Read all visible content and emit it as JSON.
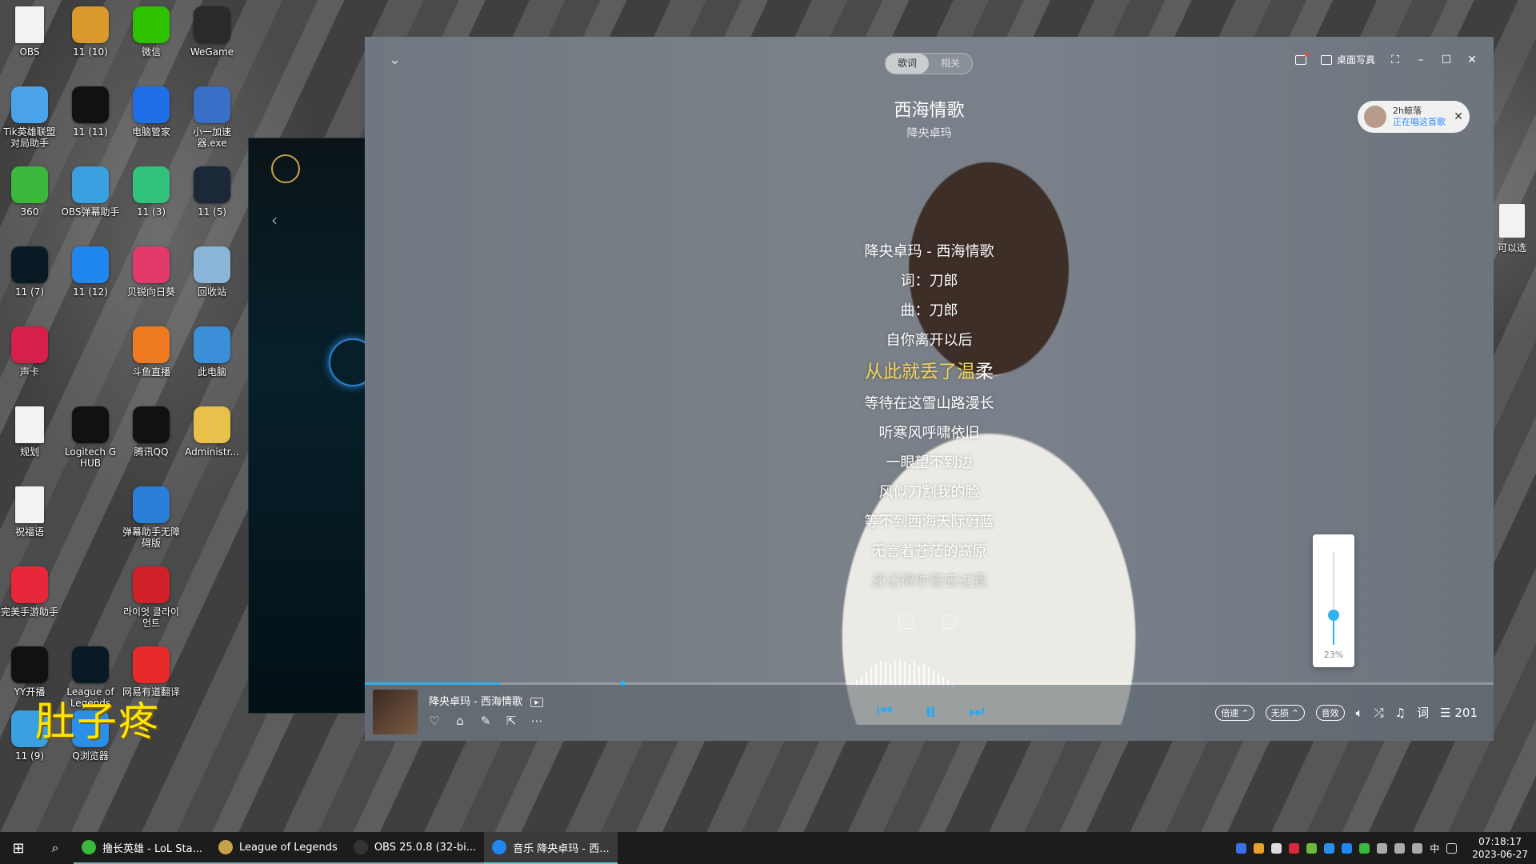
{
  "desktop": {
    "icons": [
      {
        "label": "OBS",
        "icon": "file-icon",
        "color": "#f2f2f2"
      },
      {
        "label": "11 (10)",
        "icon": "cat-icon",
        "color": "#d99a2b"
      },
      {
        "label": "微信",
        "icon": "wechat-icon",
        "color": "#2dc100"
      },
      {
        "label": "WeGame",
        "icon": "wegame-icon",
        "color": "#2a2a2a"
      },
      {
        "label": "Tik英雄联盟对局助手",
        "icon": "tik-icon",
        "color": "#4aa3e8"
      },
      {
        "label": "11 (11)",
        "icon": "capcut-icon",
        "color": "#111111"
      },
      {
        "label": "电脑管家",
        "icon": "shield-icon",
        "color": "#1f6fe6"
      },
      {
        "label": "小一加速器.exe",
        "icon": "accelerator-icon",
        "color": "#3a6fc8"
      },
      {
        "label": "360",
        "icon": "browser-360-icon",
        "color": "#3cb93c"
      },
      {
        "label": "OBS弹幕助手",
        "icon": "globe-icon",
        "color": "#3aa0e0"
      },
      {
        "label": "11 (3)",
        "icon": "qqmusic-icon",
        "color": "#31c27c"
      },
      {
        "label": "11 (5)",
        "icon": "steam-icon",
        "color": "#1b2838"
      },
      {
        "label": "11 (7)",
        "icon": "lol-icon",
        "color": "#0a1a24"
      },
      {
        "label": "11 (12)",
        "icon": "kugou-icon",
        "color": "#2086f0"
      },
      {
        "label": "贝锐向日葵",
        "icon": "sunflower-icon",
        "color": "#e23a6a"
      },
      {
        "label": "回收站",
        "icon": "recycle-bin-icon",
        "color": "#8ab4d8"
      },
      {
        "label": "声卡",
        "icon": "soundcard-icon",
        "color": "#d4204a"
      },
      {
        "label": "斗鱼直播",
        "icon": "douyu-icon",
        "color": "#f07a22"
      },
      {
        "label": "此电脑",
        "icon": "computer-icon",
        "color": "#3a8fd8"
      },
      {
        "label": "规划",
        "icon": "file-icon",
        "color": "#f2f2f2"
      },
      {
        "label": "Logitech G HUB",
        "icon": "logitech-icon",
        "color": "#111111"
      },
      {
        "label": "腾讯QQ",
        "icon": "qq-icon",
        "color": "#111111"
      },
      {
        "label": "Administr...",
        "icon": "user-folder-icon",
        "color": "#e8c04a"
      },
      {
        "label": "祝福语",
        "icon": "file-icon",
        "color": "#f2f2f2"
      },
      {
        "label": "弹幕助手无障碍版",
        "icon": "danmaku-icon",
        "color": "#2a7fd8"
      },
      {
        "label": "完美手游助手",
        "icon": "heart-app-icon",
        "color": "#e8283a"
      },
      {
        "label": "라이엇 클라이언트",
        "icon": "riot-icon",
        "color": "#d0202a"
      },
      {
        "label": "YY开播",
        "icon": "yy-icon",
        "color": "#111111"
      },
      {
        "label": "League of Legends",
        "icon": "lol-icon",
        "color": "#0a1a24"
      },
      {
        "label": "网易有道翻译",
        "icon": "youdao-icon",
        "color": "#e82a2a"
      },
      {
        "label": "11 (9)",
        "icon": "penguin-icon",
        "color": "#3aa0e0"
      },
      {
        "label": "Q浏览器",
        "icon": "qbrowser-icon",
        "color": "#2a8fe8"
      }
    ],
    "right_icon_label": "可以选",
    "overlay_text": "肚子疼"
  },
  "player": {
    "tabs": [
      {
        "label": "歌词",
        "active": true
      },
      {
        "label": "相关",
        "active": false
      }
    ],
    "title": "西海情歌",
    "artist": "降央卓玛",
    "topbar": {
      "desktop_portrait_label": "桌面写真"
    },
    "listener": {
      "name": "2h鲸落",
      "status": "正在唱这首歌"
    },
    "lyrics": [
      {
        "text": "降央卓玛 - 西海情歌",
        "state": "normal"
      },
      {
        "text": "词：刀郎",
        "state": "normal"
      },
      {
        "text": "曲：刀郎",
        "state": "normal"
      },
      {
        "text": "自你离开以后",
        "state": "normal"
      },
      {
        "text": "从此就丢了温柔",
        "state": "current",
        "played": "从此就丢了温",
        "rest": "柔"
      },
      {
        "text": "等待在这雪山路漫长",
        "state": "normal"
      },
      {
        "text": "听寒风呼啸依旧",
        "state": "normal"
      },
      {
        "text": "一眼望不到边",
        "state": "normal"
      },
      {
        "text": "风似刀割我的脸",
        "state": "normal"
      },
      {
        "text": "等不到西海天际蔚蓝",
        "state": "normal"
      },
      {
        "text": "无言着苍茫的高原",
        "state": "normal"
      },
      {
        "text": "还记得你答应过我",
        "state": "dim"
      }
    ],
    "progress": 0.26,
    "now_playing": "降央卓玛 - 西海情歌",
    "controls": {
      "speed_label": "倍速",
      "quality_label": "无损",
      "effect_label": "音效",
      "lyrics_label": "词",
      "playlist_count": "201"
    },
    "volume": {
      "percent_label": "23%",
      "level": 0.23
    },
    "accent_color": "#2fb2f0",
    "lyric_highlight_color": "#f1d35a"
  },
  "taskbar": {
    "tasks": [
      {
        "label": "撸长英雄 - LoL Sta...",
        "icon": "lol-helper-icon",
        "color": "#3cb93c",
        "active": false
      },
      {
        "label": "League of Legends",
        "icon": "lol-icon",
        "color": "#c8a24a",
        "active": false
      },
      {
        "label": "OBS 25.0.8 (32-bi...",
        "icon": "obs-icon",
        "color": "#333333",
        "active": false
      },
      {
        "label": "音乐 降央卓玛 - 西...",
        "icon": "kugou-icon",
        "color": "#2086f0",
        "active": true
      }
    ],
    "ime": "中",
    "time": "07:18:17",
    "date": "2023-06-27"
  }
}
